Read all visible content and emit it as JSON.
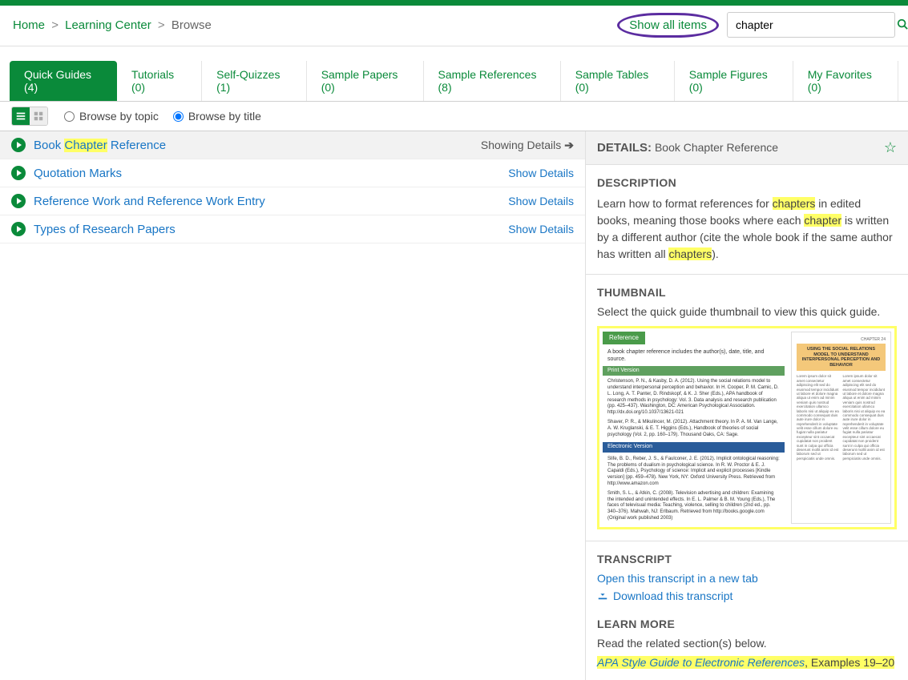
{
  "breadcrumb": {
    "home": "Home",
    "learning": "Learning Center",
    "browse": "Browse"
  },
  "header": {
    "show_all": "Show all items",
    "search_value": "chapter"
  },
  "tabs": [
    {
      "label": "Quick Guides (4)",
      "active": true
    },
    {
      "label": "Tutorials (0)"
    },
    {
      "label": "Self-Quizzes (1)"
    },
    {
      "label": "Sample Papers (0)"
    },
    {
      "label": "Sample References (8)"
    },
    {
      "label": "Sample Tables (0)"
    },
    {
      "label": "Sample Figures (0)"
    },
    {
      "label": "My Favorites (0)"
    }
  ],
  "toolbar": {
    "browse_topic": "Browse by topic",
    "browse_title": "Browse by title"
  },
  "list": [
    {
      "pre": "Book ",
      "hl": "Chapter",
      "post": " Reference",
      "action": "Showing Details",
      "selected": true
    },
    {
      "title": "Quotation Marks",
      "action": "Show Details"
    },
    {
      "title": "Reference Work and Reference Work Entry",
      "action": "Show Details"
    },
    {
      "title": "Types of Research Papers",
      "action": "Show Details"
    }
  ],
  "details": {
    "label": "DETAILS:",
    "title": "Book Chapter Reference",
    "desc_heading": "DESCRIPTION",
    "desc_p1": "Learn how to format references for ",
    "desc_h1": "chapters",
    "desc_p2": " in edited books, meaning those books where each ",
    "desc_h2": "chapter",
    "desc_p3": " is written by a different author (cite the whole book if the same author has written all ",
    "desc_h3": "chapters",
    "desc_p4": ").",
    "thumb_heading": "THUMBNAIL",
    "thumb_caption": "Select the quick guide thumbnail to view this quick guide.",
    "transcript_heading": "TRANSCRIPT",
    "open_transcript": "Open this transcript in a new tab",
    "download_transcript": "Download this transcript",
    "learn_heading": "LEARN MORE",
    "learn_text": "Read the related section(s) below.",
    "learn_link": "APA Style Guide to Electronic References",
    "learn_suffix": ", Examples 19–20"
  },
  "thumb": {
    "badge": "Reference",
    "intro": "A book chapter reference includes the author(s), date, title, and source.",
    "bar1": "Print Version",
    "para1": "Christenson, P. N., & Kasby, D. A. (2012). Using the social relations model to understand interpersonal perception and behavior. In H. Cooper, P. M. Camic, D. L. Long, A. T. Panter, D. Rindskopf, & K. J. Sher (Eds.), APA handbook of research methods in psychology: Vol. 3. Data analysis and research publication (pp. 425–437). Washington, DC: American Psychological Association. http://dx.doi.org/10.1037/13621-021",
    "para2": "Shaver, P. R., & Mikulincer, M. (2012). Attachment theory. In P. A. M. Van Lange, A. W. Kruglanski, & E. T. Higgins (Eds.), Handbook of theories of social psychology (Vol. 2, pp. 160–179). Thousand Oaks, CA: Sage.",
    "bar2": "Electronic Version",
    "para3": "Slife, B. D., Reber, J. S., & Faulconer, J. E. (2012). Implicit ontological reasoning: The problems of dualism in psychological science. In R. W. Proctor & E. J. Capaldi (Eds.), Psychology of science: Implicit and explicit processes [Kindle version] (pp. 459–478). New York, NY: Oxford University Press. Retrieved from http://www.amazon.com",
    "para4": "Smith, S. L., & Atkin, C. (2008). Television advertising and children: Examining the intended and unintended effects. In E. L. Palmer & B. M. Young (Eds.), The faces of televisual media: Teaching, violence, selling to children (2nd ed., pp. 340–376). Mahwah, NJ: Erlbaum. Retrieved from http://books.google.com (Original work published 2003)",
    "right_title": "USING THE SOCIAL RELATIONS MODEL TO UNDERSTAND INTERPERSONAL PERCEPTION AND BEHAVIOR"
  }
}
